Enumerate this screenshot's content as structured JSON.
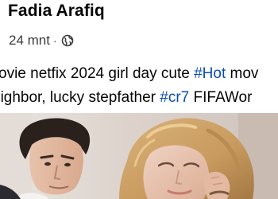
{
  "post": {
    "author": "Fadia Arafiq",
    "time": "24 mnt",
    "separator": "·",
    "privacy_icon": "globe-icon",
    "caption": {
      "line1_text": "ovie netfix 2024 girl day cute ",
      "line1_hashtag": "#Hot",
      "line1_tail": " mov",
      "line2_text": "eighbor, lucky stepfather ",
      "line2_hashtag": "#cr7",
      "line2_tail": " FIFAWor"
    },
    "photo": {
      "description_icon": "photo-thumbnail"
    }
  },
  "colors": {
    "text": "#050505",
    "secondary": "#3a3b3c",
    "hashtag": "#0a4db3",
    "background": "#ffffff"
  }
}
